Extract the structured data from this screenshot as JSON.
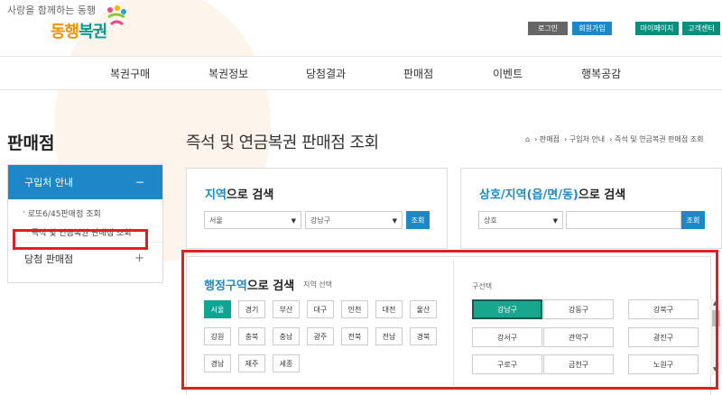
{
  "header": {
    "tagline": "사랑을 함께하는 동행",
    "brand_part1": "동행",
    "brand_part2": "복권",
    "buttons": [
      {
        "label": "로그인",
        "color": "#666666"
      },
      {
        "label": "회원가입",
        "color": "#1e88c6"
      },
      {
        "label": "마이페이지",
        "color": "#0a8f7f"
      },
      {
        "label": "고객센터",
        "color": "#0a8f7f"
      }
    ]
  },
  "nav": {
    "items": [
      "복권구매",
      "복권정보",
      "당첨결과",
      "판매점",
      "이벤트",
      "행복공감"
    ]
  },
  "sidebar": {
    "title": "판매점",
    "active_group": "구입처 안내",
    "sub_items": [
      "로또6/45판매점 조회",
      "즉석 및 연금복권 판매점 조회"
    ],
    "group2": "당첨 판매점"
  },
  "page": {
    "title": "즉석 및 연금복권 판매점 조회",
    "breadcrumb": [
      "판매점",
      "구입처 안내",
      "즉석 및 연금복권 판매점 조회"
    ]
  },
  "region_search": {
    "title_highlight": "지역",
    "title_rest": "으로 검색",
    "city": "서울",
    "district": "강남구",
    "button": "조회"
  },
  "name_search": {
    "title_highlight": "상호/지역(읍/면/동)",
    "title_rest": "으로 검색",
    "type": "상호",
    "value": "",
    "button": "조회"
  },
  "admin_search": {
    "title_highlight": "행정구역",
    "title_rest": "으로 검색",
    "hint": "지역 선택",
    "regions": [
      "서울",
      "경기",
      "부산",
      "대구",
      "인천",
      "대전",
      "울산",
      "강원",
      "충북",
      "충남",
      "광주",
      "전북",
      "전남",
      "경북",
      "경남",
      "제주",
      "세종"
    ],
    "selected_region": "서울",
    "district_label": "구선택",
    "districts": [
      "강남구",
      "강동구",
      "강북구",
      "강서구",
      "관악구",
      "광진구",
      "구로구",
      "금천구",
      "노원구"
    ],
    "selected_district": "강남구"
  },
  "colors": {
    "accent": "#1e88c6",
    "teal": "#0fa394",
    "highlight_box": "#e02020"
  }
}
